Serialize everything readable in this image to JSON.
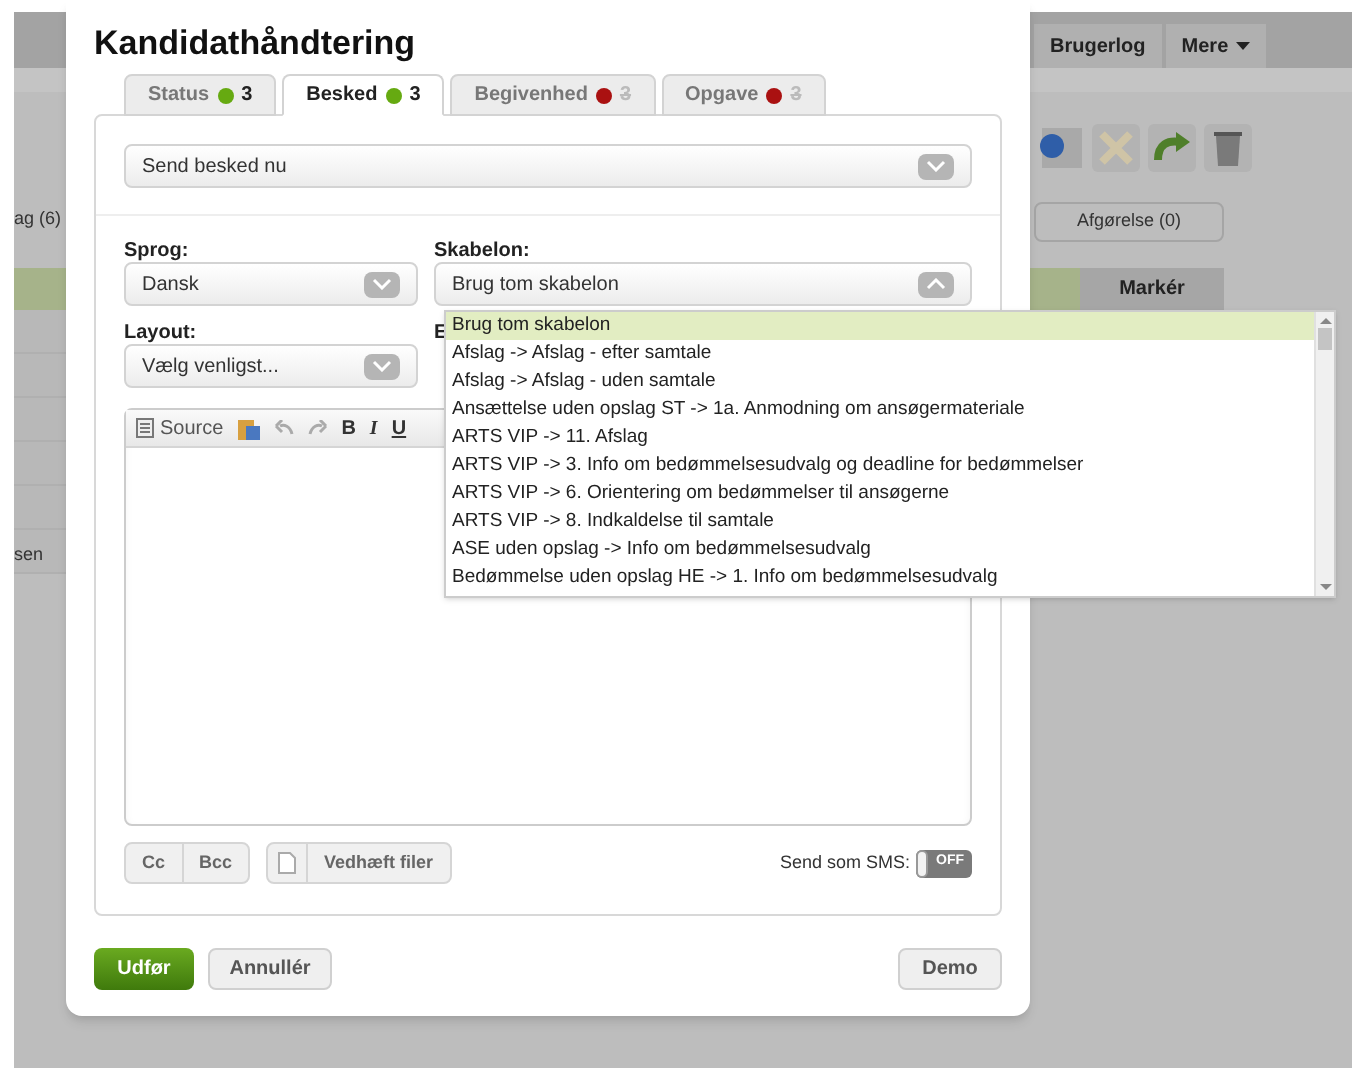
{
  "background": {
    "header_buttons": [
      {
        "label": "Brugerlog",
        "kind": "log"
      },
      {
        "label": "Mere",
        "kind": "menu"
      }
    ],
    "left_tab": "ag (6)",
    "right_tab": "Afgørelse (0)",
    "column_header": "Markér",
    "row_text": "sen"
  },
  "dialog": {
    "title": "Kandidathåndtering",
    "tabs": [
      {
        "label": "Status",
        "color": "#66aa11",
        "count": "3",
        "selected": false,
        "count_muted": false
      },
      {
        "label": "Besked",
        "color": "#66aa11",
        "count": "3",
        "selected": true,
        "count_muted": false
      },
      {
        "label": "Begivenhed",
        "color": "#aa1111",
        "count": "3",
        "selected": false,
        "count_muted": true
      },
      {
        "label": "Opgave",
        "color": "#aa1111",
        "count": "3",
        "selected": false,
        "count_muted": true
      }
    ],
    "send_mode": "Send besked nu",
    "language": {
      "label": "Sprog:",
      "value": "Dansk"
    },
    "template": {
      "label": "Skabelon:",
      "value": "Brug tom skabelon",
      "expanded": true,
      "options": [
        {
          "label": "Brug tom skabelon",
          "selected": true
        },
        {
          "label": "Afslag -> Afslag - efter samtale",
          "selected": false
        },
        {
          "label": "Afslag -> Afslag - uden samtale",
          "selected": false
        },
        {
          "label": "Ansættelse uden opslag ST -> 1a. Anmodning om ansøgermateriale",
          "selected": false
        },
        {
          "label": "ARTS VIP -> 11. Afslag",
          "selected": false
        },
        {
          "label": "ARTS VIP -> 3. Info om bedømmelsesudvalg og deadline for bedømmelser",
          "selected": false
        },
        {
          "label": "ARTS VIP -> 6. Orientering om bedømmelser til ansøgerne",
          "selected": false
        },
        {
          "label": "ARTS VIP -> 8. Indkaldelse til samtale",
          "selected": false
        },
        {
          "label": "ASE uden opslag -> Info om bedømmelsesudvalg",
          "selected": false
        },
        {
          "label": "Bedømmelse uden opslag HE -> 1. Info om bedømmelsesudvalg",
          "selected": false
        }
      ]
    },
    "layout": {
      "label": "Layout:",
      "value": "Vælg venligst..."
    },
    "subject_label": "E",
    "editor_toolbar": {
      "source": "Source",
      "bold": "B",
      "italic": "I",
      "underline": "U"
    },
    "recipient_buttons": [
      "Cc",
      "Bcc"
    ],
    "attach": "Vedhæft filer",
    "sms": {
      "label": "Send som SMS:",
      "on": false,
      "off_text": "OFF"
    },
    "footer": {
      "primary": "Udfør",
      "cancel": "Annullér",
      "demo": "Demo"
    }
  }
}
